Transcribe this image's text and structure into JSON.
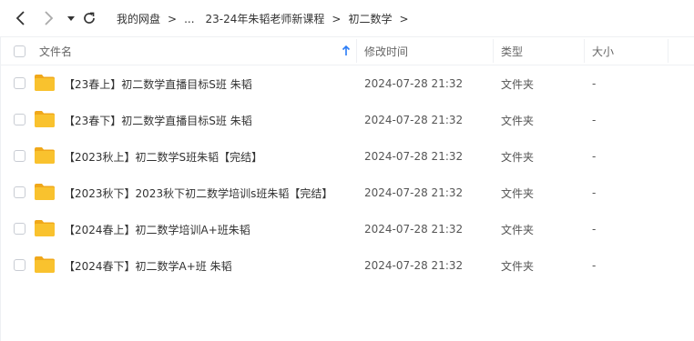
{
  "nav": {
    "back_icon": "chevron-left-icon",
    "forward_icon": "chevron-right-icon",
    "dropdown_icon": "caret-down-icon",
    "refresh_icon": "refresh-icon"
  },
  "breadcrumb": {
    "items": [
      "我的网盘",
      "...",
      "23-24年朱韬老师新课程",
      "初二数学"
    ],
    "separator": ">"
  },
  "table": {
    "headers": {
      "name": "文件名",
      "modified": "修改时间",
      "type": "类型",
      "size": "大小"
    },
    "sort_icon": "sort-up-arrow-icon",
    "rows": [
      {
        "name": "【23春上】初二数学直播目标S班  朱韬",
        "modified": "2024-07-28 21:32",
        "type": "文件夹",
        "size": "-"
      },
      {
        "name": "【23春下】初二数学直播目标S班  朱韬",
        "modified": "2024-07-28 21:32",
        "type": "文件夹",
        "size": "-"
      },
      {
        "name": "【2023秋上】初二数学S班朱韬【完结】",
        "modified": "2024-07-28 21:32",
        "type": "文件夹",
        "size": "-"
      },
      {
        "name": "【2023秋下】2023秋下初二数学培训s班朱韬【完结】",
        "modified": "2024-07-28 21:32",
        "type": "文件夹",
        "size": "-"
      },
      {
        "name": "【2024春上】初二数学培训A+班朱韬",
        "modified": "2024-07-28 21:32",
        "type": "文件夹",
        "size": "-"
      },
      {
        "name": "【2024春下】初二数学A+班 朱韬",
        "modified": "2024-07-28 21:32",
        "type": "文件夹",
        "size": "-"
      }
    ]
  },
  "colors": {
    "folder": "#f9c22e",
    "folder_dark": "#f0a81a",
    "sort_arrow": "#2a7cf6"
  }
}
